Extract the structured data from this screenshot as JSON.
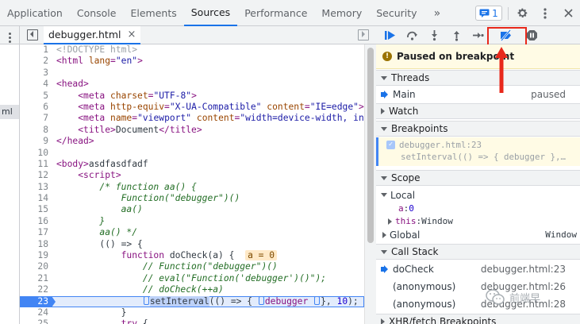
{
  "tabs": [
    {
      "label": "Application",
      "active": false
    },
    {
      "label": "Console",
      "active": false
    },
    {
      "label": "Elements",
      "active": false
    },
    {
      "label": "Sources",
      "active": true
    },
    {
      "label": "Performance",
      "active": false
    },
    {
      "label": "Memory",
      "active": false
    },
    {
      "label": "Security",
      "active": false
    }
  ],
  "more_tabs_label": "»",
  "issues_count": "1",
  "icons": {
    "issues": "chat-bubble-icon",
    "settings": "gear-icon",
    "menu": "vertical-dots-icon",
    "close": "close-icon"
  },
  "navigator": {
    "selected_fragment": "ml"
  },
  "editor": {
    "file_tab_label": "debugger.html",
    "file_tab_close": "×",
    "lines": [
      {
        "n": "1",
        "tokens": [
          {
            "c": "t-doc",
            "t": "<!DOCTYPE html>"
          }
        ]
      },
      {
        "n": "2",
        "tokens": [
          {
            "c": "t-tag",
            "t": "<html "
          },
          {
            "c": "t-at",
            "t": "lang"
          },
          {
            "c": "t-tag",
            "t": "="
          },
          {
            "c": "t-av",
            "t": "\"en\""
          },
          {
            "c": "t-tag",
            "t": ">"
          }
        ]
      },
      {
        "n": "3",
        "tokens": []
      },
      {
        "n": "4",
        "tokens": [
          {
            "c": "t-tag",
            "t": "<head>"
          }
        ]
      },
      {
        "n": "5",
        "tokens": [
          {
            "c": "",
            "t": "    "
          },
          {
            "c": "t-tag",
            "t": "<meta "
          },
          {
            "c": "t-at",
            "t": "charset"
          },
          {
            "c": "t-tag",
            "t": "="
          },
          {
            "c": "t-av",
            "t": "\"UTF-8\""
          },
          {
            "c": "t-tag",
            "t": ">"
          }
        ]
      },
      {
        "n": "6",
        "tokens": [
          {
            "c": "",
            "t": "    "
          },
          {
            "c": "t-tag",
            "t": "<meta "
          },
          {
            "c": "t-at",
            "t": "http-equiv"
          },
          {
            "c": "t-tag",
            "t": "="
          },
          {
            "c": "t-av",
            "t": "\"X-UA-Compatible\""
          },
          {
            "c": "t-tag",
            "t": " "
          },
          {
            "c": "t-at",
            "t": "content"
          },
          {
            "c": "t-tag",
            "t": "="
          },
          {
            "c": "t-av",
            "t": "\"IE=edge\""
          },
          {
            "c": "t-tag",
            "t": ">"
          }
        ]
      },
      {
        "n": "7",
        "tokens": [
          {
            "c": "",
            "t": "    "
          },
          {
            "c": "t-tag",
            "t": "<meta "
          },
          {
            "c": "t-at",
            "t": "name"
          },
          {
            "c": "t-tag",
            "t": "="
          },
          {
            "c": "t-av",
            "t": "\"viewport\""
          },
          {
            "c": "t-tag",
            "t": " "
          },
          {
            "c": "t-at",
            "t": "content"
          },
          {
            "c": "t-tag",
            "t": "="
          },
          {
            "c": "t-av",
            "t": "\"width=device-width, init"
          }
        ]
      },
      {
        "n": "8",
        "tokens": [
          {
            "c": "",
            "t": "    "
          },
          {
            "c": "t-tag",
            "t": "<title>"
          },
          {
            "c": "",
            "t": "Document"
          },
          {
            "c": "t-tag",
            "t": "</title>"
          }
        ]
      },
      {
        "n": "9",
        "tokens": [
          {
            "c": "t-tag",
            "t": "</head>"
          }
        ]
      },
      {
        "n": "10",
        "tokens": []
      },
      {
        "n": "11",
        "tokens": [
          {
            "c": "t-tag",
            "t": "<body>"
          },
          {
            "c": "",
            "t": "asdfasdfadf"
          }
        ]
      },
      {
        "n": "12",
        "tokens": [
          {
            "c": "",
            "t": "    "
          },
          {
            "c": "t-tag",
            "t": "<script>"
          }
        ]
      },
      {
        "n": "13",
        "tokens": [
          {
            "c": "",
            "t": "        "
          },
          {
            "c": "t-it",
            "t": "/* function aa() {"
          }
        ]
      },
      {
        "n": "14",
        "tokens": [
          {
            "c": "",
            "t": "            "
          },
          {
            "c": "t-it",
            "t": "Function(\"debugger\")()"
          }
        ]
      },
      {
        "n": "15",
        "tokens": [
          {
            "c": "",
            "t": "            "
          },
          {
            "c": "t-it",
            "t": "aa()"
          }
        ]
      },
      {
        "n": "16",
        "tokens": [
          {
            "c": "",
            "t": "        "
          },
          {
            "c": "t-it",
            "t": "}"
          }
        ]
      },
      {
        "n": "17",
        "tokens": [
          {
            "c": "",
            "t": "        "
          },
          {
            "c": "t-it",
            "t": "aa() */"
          }
        ]
      },
      {
        "n": "18",
        "tokens": [
          {
            "c": "",
            "t": "        (() => {"
          }
        ]
      },
      {
        "n": "19",
        "tokens": [
          {
            "c": "",
            "t": "            "
          },
          {
            "c": "t-kw",
            "t": "function"
          },
          {
            "c": "",
            "t": " doCheck(a) {  "
          },
          {
            "c": "inline-val",
            "t": "a = 0"
          }
        ]
      },
      {
        "n": "20",
        "tokens": [
          {
            "c": "",
            "t": "                "
          },
          {
            "c": "t-it",
            "t": "// Function(\"debugger\")()"
          }
        ]
      },
      {
        "n": "21",
        "tokens": [
          {
            "c": "",
            "t": "                "
          },
          {
            "c": "t-it",
            "t": "// eval(\"Function('debugger')()\");"
          }
        ]
      },
      {
        "n": "22",
        "tokens": [
          {
            "c": "",
            "t": "                "
          },
          {
            "c": "t-it",
            "t": "// doCheck(++a)"
          }
        ]
      },
      {
        "n": "23",
        "exec": true,
        "tokens": [
          {
            "c": "",
            "t": "                "
          },
          {
            "c": "bp",
            "t": ""
          },
          {
            "c": "hl-call",
            "t": "setInterval"
          },
          {
            "c": "",
            "t": "(() => { "
          },
          {
            "c": "bp",
            "t": ""
          },
          {
            "c": "t-kw",
            "t": "debugger"
          },
          {
            "c": "",
            "t": " "
          },
          {
            "c": "bp",
            "t": ""
          },
          {
            "c": "",
            "t": "}, "
          },
          {
            "c": "t-num",
            "t": "10"
          },
          {
            "c": "",
            "t": ");"
          }
        ]
      },
      {
        "n": "24",
        "tokens": [
          {
            "c": "",
            "t": "            }"
          }
        ]
      },
      {
        "n": "25",
        "tokens": [
          {
            "c": "",
            "t": "            "
          },
          {
            "c": "t-kw",
            "t": "try"
          },
          {
            "c": "",
            "t": " {"
          }
        ]
      }
    ]
  },
  "debugger": {
    "paused_label": "Paused on breakpoint",
    "sections": {
      "threads": "Threads",
      "watch": "Watch",
      "breakpoints": "Breakpoints",
      "scope": "Scope",
      "call_stack": "Call Stack",
      "xhr": "XHR/fetch Breakpoints"
    },
    "threads": [
      {
        "name": "Main",
        "status": "paused"
      }
    ],
    "breakpoint": {
      "location": "debugger.html:23",
      "code": "setInterval(() => { debugger },…"
    },
    "scope": {
      "local_label": "Local",
      "vars": [
        {
          "name": "a",
          "value": "0"
        }
      ],
      "this_label": "this",
      "this_value": "Window",
      "global_label": "Global",
      "global_value": "Window"
    },
    "call_stack": [
      {
        "name": "doCheck",
        "loc": "debugger.html:23",
        "current": true
      },
      {
        "name": "(anonymous)",
        "loc": "debugger.html:26",
        "current": false
      },
      {
        "name": "(anonymous)",
        "loc": "debugger.html:28",
        "current": false
      }
    ]
  },
  "watermark_text": "前端早",
  "colors": {
    "accent": "#1a73e8",
    "annotation": "#e8281b",
    "paused_bg": "#fffbe5"
  }
}
